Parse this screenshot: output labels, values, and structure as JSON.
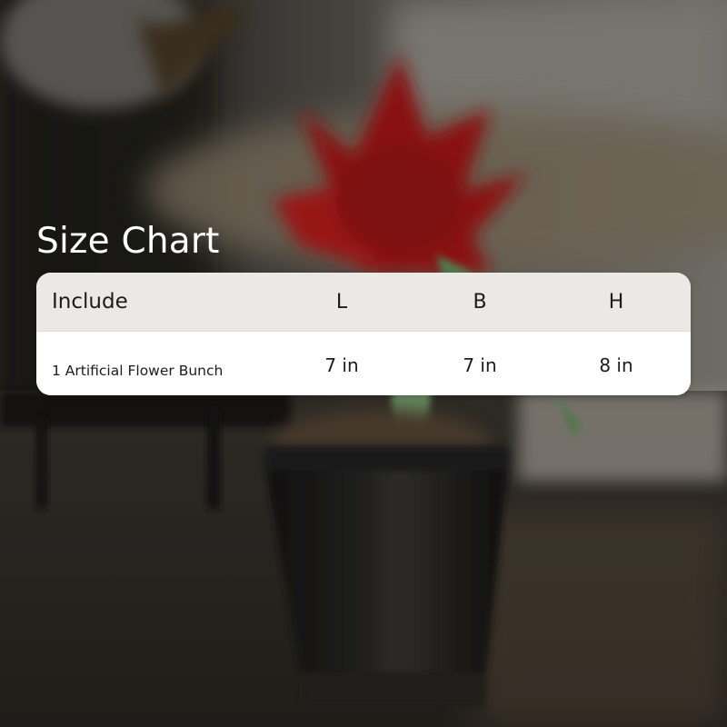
{
  "title": "Size Chart",
  "table": {
    "headers": [
      "Include",
      "L",
      "B",
      "H"
    ],
    "rows": [
      [
        "1 Artificial Flower Bunch",
        "7 in",
        "7 in",
        "8 in"
      ]
    ]
  },
  "colors": {
    "title_text": "#ffffff",
    "header_background": "#ebe9e5",
    "row_background": "#ffffff",
    "table_text": "#1c1c1c",
    "flower_red": "#c21a1a",
    "leaf_green": "#7fae78",
    "pot_dark": "#1e1c1b",
    "backdrop_dark": "#2a2622"
  }
}
